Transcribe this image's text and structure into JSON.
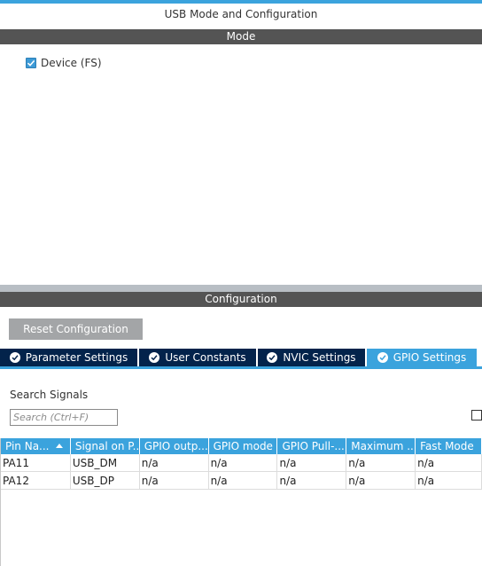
{
  "window": {
    "title": "USB Mode and Configuration"
  },
  "mode": {
    "header": "Mode",
    "device_checkbox": {
      "label": "Device (FS)",
      "checked": true
    }
  },
  "configuration": {
    "header": "Configuration",
    "reset_label": "Reset Configuration",
    "tabs": [
      {
        "label": "Parameter Settings",
        "active": false
      },
      {
        "label": "User Constants",
        "active": false
      },
      {
        "label": "NVIC Settings",
        "active": false
      },
      {
        "label": "GPIO Settings",
        "active": true
      }
    ]
  },
  "search": {
    "label": "Search Signals",
    "placeholder": "Search (Ctrl+F)",
    "value": ""
  },
  "table": {
    "columns": [
      "Pin Na...",
      "Signal on P...",
      "GPIO outp...",
      "GPIO mode",
      "GPIO Pull-...",
      "Maximum ...",
      "Fast Mode"
    ],
    "rows": [
      [
        "PA11",
        "USB_DM",
        "n/a",
        "n/a",
        "n/a",
        "n/a",
        "n/a"
      ],
      [
        "PA12",
        "USB_DP",
        "n/a",
        "n/a",
        "n/a",
        "n/a",
        "n/a"
      ]
    ]
  },
  "colors": {
    "accent": "#3ba3dd",
    "tab_inactive": "#03234b",
    "section_bar": "#545454",
    "button": "#a3a5a7"
  }
}
